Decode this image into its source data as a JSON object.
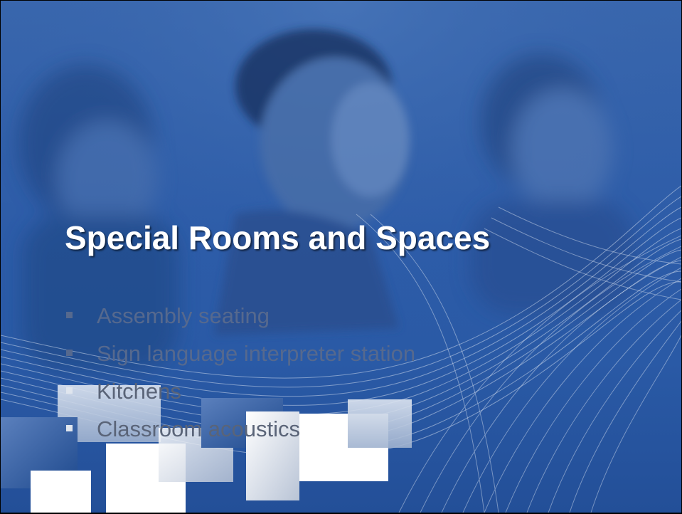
{
  "slide": {
    "title": "Special Rooms and Spaces",
    "bullets": [
      "Assembly seating",
      "Sign language interpreter station",
      "Kitchens",
      "Classroom acoustics"
    ]
  }
}
